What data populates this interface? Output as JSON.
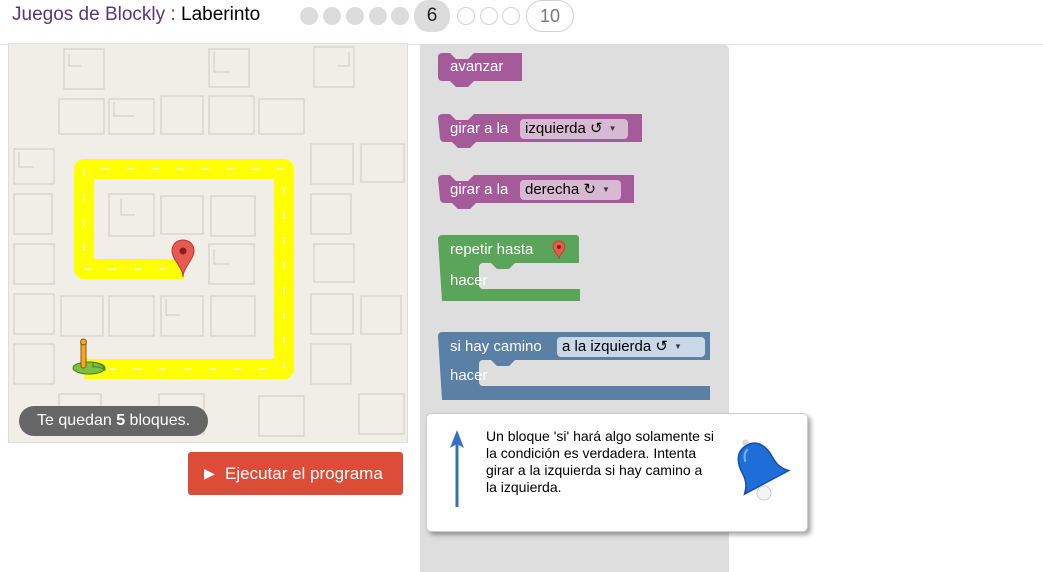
{
  "header": {
    "app_name": "Juegos de Blockly",
    "separator": " : ",
    "page_name": "Laberinto",
    "current_level": "6",
    "last_level": "10"
  },
  "maze": {
    "capacity_prefix": "Te quedan ",
    "capacity_count": "5",
    "capacity_suffix": " bloques."
  },
  "run_button": {
    "label": "Ejecutar el programa"
  },
  "toolbox": {
    "move_forward": "avanzar",
    "turn_left_label": "girar a la",
    "turn_left_option": "izquierda ↺",
    "turn_right_label": "girar a la",
    "turn_right_option": "derecha ↻",
    "repeat_label": "repetir hasta",
    "repeat_do": "hacer",
    "if_label": "si hay camino",
    "if_option": "a la izquierda ↺",
    "if_do": "hacer"
  },
  "hint": {
    "text": "Un bloque 'si' hará algo solamente si la condición es verdadera. Intenta girar a la izquierda si hay camino a la izquierda."
  },
  "colors": {
    "motion_block": "#a55b99",
    "loop_block": "#5ba55b",
    "logic_block": "#5b80a5",
    "path": "#ffff00",
    "run_button": "#dd4b39"
  }
}
